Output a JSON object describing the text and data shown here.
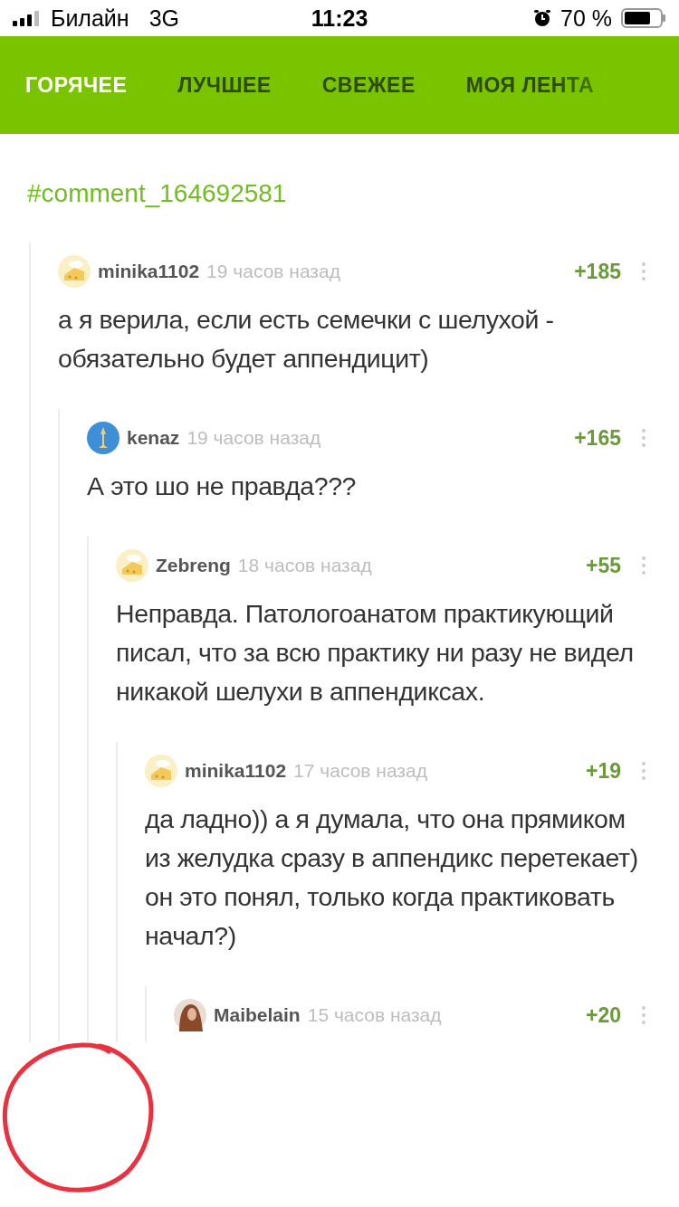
{
  "status_bar": {
    "carrier": "Билайн",
    "network": "3G",
    "time": "11:23",
    "battery": "70 %"
  },
  "tabs": [
    {
      "label": "ГОРЯЧЕЕ",
      "selected": true
    },
    {
      "label": "ЛУЧШЕЕ",
      "selected": false
    },
    {
      "label": "СВЕЖЕЕ",
      "selected": false
    },
    {
      "label": "МОЯ ЛЕНТА",
      "selected": false
    }
  ],
  "comment_link": "#comment_164692581",
  "comments": [
    {
      "author": "minika1102",
      "kind": "default",
      "time": "19 часов назад",
      "score": "+185",
      "text": "а я верила, если есть семечки с шелухой - обязательно будет аппендицит)",
      "children": [
        {
          "author": "kenaz",
          "kind": "badge",
          "time": "19 часов назад",
          "score": "+165",
          "text": "А это шо не правда???",
          "children": [
            {
              "author": "Zebreng",
              "kind": "default",
              "time": "18 часов назад",
              "score": "+55",
              "text": "Неправда. Патологоанатом практикующий писал, что за всю практику ни разу не видел никакой шелухи в аппендиксах.",
              "children": [
                {
                  "author": "minika1102",
                  "kind": "default",
                  "time": "17 часов назад",
                  "score": "+19",
                  "text": "да ладно)) а я думала, что она прямиком из желудка сразу в аппендикс перетекает)\nон это понял, только когда практиковать начал?)",
                  "children": [
                    {
                      "author": "Maibelain",
                      "kind": "photo",
                      "time": "15 часов назад",
                      "score": "+20"
                    }
                  ]
                }
              ]
            }
          ]
        }
      ]
    }
  ]
}
